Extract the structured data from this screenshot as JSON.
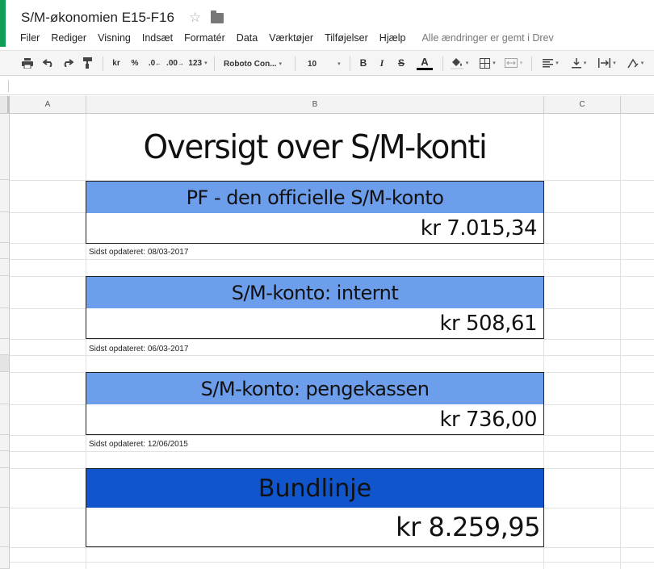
{
  "document": {
    "title": "S/M-økonomien E15-F16"
  },
  "menu": {
    "items": [
      "Filer",
      "Rediger",
      "Visning",
      "Indsæt",
      "Formatér",
      "Data",
      "Værktøjer",
      "Tilføjelser",
      "Hjælp"
    ],
    "save_status": "Alle ændringer er gemt i Drev"
  },
  "toolbar": {
    "currency": "kr",
    "percent": "%",
    "decrease_decimals": ".0",
    "increase_decimals": ".00",
    "more_formats": "123",
    "font": "Roboto Con...",
    "font_size": "10",
    "bold": "B",
    "italic": "I",
    "strikethrough": "S",
    "text_color": "A"
  },
  "columns": [
    "A",
    "B",
    "C"
  ],
  "sheet": {
    "title": "Oversigt over S/M-konti",
    "accounts": [
      {
        "name": "PF - den officielle S/M-konto",
        "balance": "kr 7.015,34",
        "updated": "Sidst opdateret: 08/03-2017"
      },
      {
        "name": "S/M-konto: internt",
        "balance": "kr 508,61",
        "updated": "Sidst opdateret: 06/03-2017"
      },
      {
        "name": "S/M-konto: pengekassen",
        "balance": "kr 736,00",
        "updated": "Sidst opdateret: 12/06/2015"
      }
    ],
    "total": {
      "label": "Bundlinje",
      "balance": "kr 8.259,95"
    }
  },
  "colors": {
    "account_header": "#6d9eeb",
    "total_header": "#1155cc",
    "brand_strip": "#0f9d58"
  }
}
